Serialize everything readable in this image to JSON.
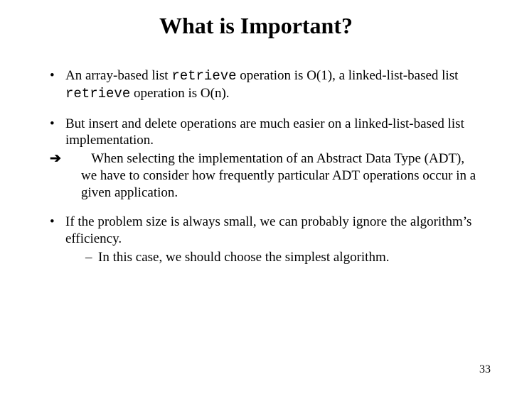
{
  "title": "What is Important?",
  "bullets": {
    "b1_pre": "An array-based list ",
    "b1_code1": "retrieve",
    "b1_mid": " operation is O(1), a linked-list-based list ",
    "b1_code2": "retrieve",
    "b1_post": " operation is O(n).",
    "b2_main": "But insert and delete operations are much easier on a linked-list-based list implementation.",
    "b2_arrow_text": "When selecting the implementation of an Abstract Data Type (ADT), we have to consider how frequently particular ADT operations occur in a given application.",
    "b3_main": "If the problem size is always small, we can probably ignore the algorithm’s efficiency.",
    "b3_sub": "In this case, we should choose the simplest algorithm."
  },
  "arrow_glyph": "➔",
  "page_number": "33"
}
